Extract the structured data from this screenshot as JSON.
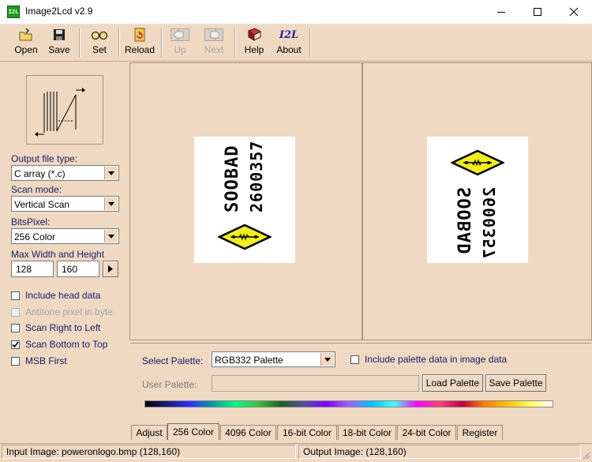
{
  "window": {
    "title": "Image2Lcd v2.9",
    "app_icon_text": "I2L"
  },
  "toolbar": {
    "open": "Open",
    "save": "Save",
    "set": "Set",
    "reload": "Reload",
    "up": "Up",
    "next": "Next",
    "help": "Help",
    "about": "About",
    "about_icon_text": "I2L"
  },
  "left": {
    "output_file_type_label": "Output file type:",
    "output_file_type_value": "C array (*.c)",
    "scan_mode_label": "Scan mode:",
    "scan_mode_value": "Vertical Scan",
    "bits_pixel_label": "BitsPixel:",
    "bits_pixel_value": "256 Color",
    "max_size_label": "Max Width and Height",
    "max_width": "128",
    "max_height": "160",
    "checkboxes": [
      {
        "label": "Include head data",
        "checked": false,
        "disabled": false
      },
      {
        "label": "Antitone pixel in byte",
        "checked": false,
        "disabled": true
      },
      {
        "label": "Scan Right to Left",
        "checked": false,
        "disabled": false
      },
      {
        "label": "Scan Bottom to Top",
        "checked": true,
        "disabled": false
      },
      {
        "label": "MSB First",
        "checked": false,
        "disabled": false
      }
    ]
  },
  "preview": {
    "input_line1": "SOOBAD",
    "input_line2": "2600357",
    "output_line1": "SOOBAD",
    "output_line2": "2600357"
  },
  "palette": {
    "select_palette_label": "Select Palette:",
    "select_palette_value": "RGB332 Palette",
    "include_palette_label": "Include palette data in image data",
    "user_palette_label": "User Palette:",
    "user_palette_value": "",
    "load_palette": "Load Palette",
    "save_palette": "Save Palette"
  },
  "tabs": [
    "Adjust",
    "256 Color",
    "4096 Color",
    "16-bit Color",
    "18-bit Color",
    "24-bit Color",
    "Register"
  ],
  "active_tab": "256 Color",
  "status": {
    "input_image": "Input Image: poweronlogo.bmp (128,160)",
    "output_image": "Output Image: (128,160)"
  }
}
